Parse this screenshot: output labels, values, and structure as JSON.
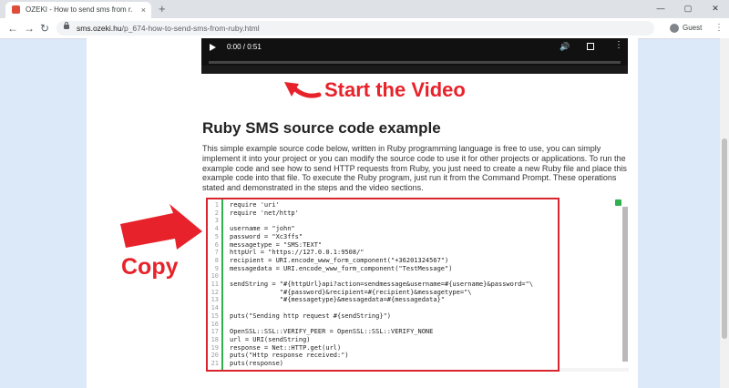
{
  "browser": {
    "tab_title": "OZEKI - How to send sms from r...",
    "tab_close": "×",
    "new_tab": "+",
    "minimize": "—",
    "maximize": "▢",
    "close": "✕",
    "back": "←",
    "forward": "→",
    "reload": "↻",
    "url_domain": "sms.ozeki.hu",
    "url_path": "/p_674-how-to-send-sms-from-ruby.html",
    "profile_label": "Guest",
    "menu": "⋮"
  },
  "video": {
    "time": "0:00 / 0:51"
  },
  "annotations": {
    "start_video": "Start the Video",
    "copy": "Copy"
  },
  "article": {
    "title": "Ruby SMS source code example",
    "description": "This simple example source code below, written in Ruby programming language is free to use, you can simply implement it into your project or you can modify the source code to use it for other projects or applications. To run the example code and see how to send HTTP requests from Ruby, you just need to create a new Ruby file and place this example code into that file. To execute the Ruby program, just run it from the Command Prompt. These operations stated and demonstrated in the steps and the video sections."
  },
  "code": {
    "lines": [
      "require 'uri'",
      "require 'net/http'",
      "",
      "username = \"john\"",
      "password = \"Xc3ffs\"",
      "messagetype = \"SMS:TEXT\"",
      "httpUrl = \"https://127.0.0.1:9508/\"",
      "recipient = URI.encode_www_form_component(\"+36201324567\")",
      "messagedata = URI.encode_www_form_component(\"TestMessage\")",
      "",
      "sendString = \"#{httpUrl}api?action=sendmessage&username=#{username}&password=\"\\",
      "             \"#{password}&recipient=#{recipient}&messagetype=\"\\",
      "             \"#{messagetype}&messagedata=#{messagedata}\"",
      "",
      "puts(\"Sending http request #{sendString}\")",
      "",
      "OpenSSL::SSL::VERIFY_PEER = OpenSSL::SSL::VERIFY_NONE",
      "url = URI(sendString)",
      "response = Net::HTTP.get(url)",
      "puts(\"Http response received:\")",
      "puts(response)"
    ]
  }
}
